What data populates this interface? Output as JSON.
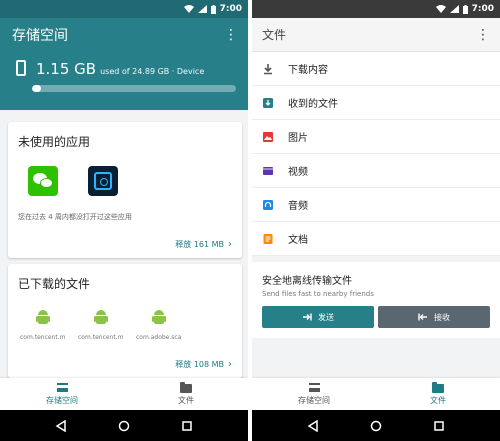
{
  "status_time": "7:00",
  "left": {
    "app_title": "存储空间",
    "storage": {
      "used_big": "1.15 GB",
      "detail": "used of 24.89 GB · Device",
      "fill_fraction": 0.046
    },
    "unused_apps": {
      "title": "未使用的应用",
      "note": "您在过去 4 周内都没打开过这些应用",
      "action": "释放 161 MB"
    },
    "downloads": {
      "title": "已下载的文件",
      "files": [
        "com.tencent.m...",
        "com.tencent.m...",
        "com.adobe.sca..."
      ],
      "action": "释放 108 MB"
    },
    "tabs": [
      "存储空间",
      "文件"
    ]
  },
  "right": {
    "app_title": "文件",
    "items": [
      "下载内容",
      "收到的文件",
      "图片",
      "视频",
      "音频",
      "文档"
    ],
    "share": {
      "title": "安全地离线传输文件",
      "subtitle": "Send files fast to nearby friends",
      "send": "发送",
      "receive": "接收"
    },
    "tabs": [
      "存储空间",
      "文件"
    ]
  },
  "colors": {
    "teal": "#277f89",
    "teal_dark": "#1f6a73",
    "wechat_green": "#2dc100",
    "android_green": "#8bc34a"
  }
}
